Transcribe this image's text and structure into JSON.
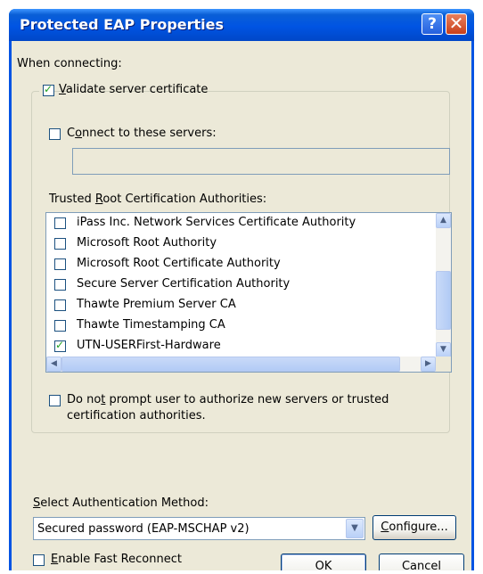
{
  "window": {
    "title": "Protected EAP Properties"
  },
  "titlebar": {
    "help_glyph": "?",
    "close_glyph": "✕"
  },
  "when_connecting": "When connecting:",
  "validate_cert": {
    "label": "Validate server certificate",
    "checked": true
  },
  "connect_servers": {
    "label": "Connect to these servers:",
    "checked": false,
    "value": ""
  },
  "trusted_root": {
    "label": "Trusted Root Certification Authorities:",
    "items": [
      {
        "label": "iPass Inc. Network Services Certificate Authority",
        "checked": false
      },
      {
        "label": "Microsoft Root Authority",
        "checked": false
      },
      {
        "label": "Microsoft Root Certificate Authority",
        "checked": false
      },
      {
        "label": "Secure Server Certification Authority",
        "checked": false
      },
      {
        "label": "Thawte Premium Server CA",
        "checked": false
      },
      {
        "label": "Thawte Timestamping CA",
        "checked": false
      },
      {
        "label": "UTN-USERFirst-Hardware",
        "checked": true
      }
    ]
  },
  "do_not_prompt": {
    "line1": "Do not prompt user to authorize new servers or trusted",
    "line2": "certification authorities.",
    "checked": false
  },
  "auth_method": {
    "label": "Select Authentication Method:",
    "value": "Secured password (EAP-MSCHAP v2)",
    "configure_label": "Configure..."
  },
  "fast_reconnect": {
    "label": "Enable Fast Reconnect",
    "checked": false
  },
  "buttons": {
    "ok": "OK",
    "cancel": "Cancel"
  },
  "colors": {
    "title_bar": "#0054e3",
    "dialog_bg": "#ece9d8",
    "check_green": "#21a121"
  }
}
